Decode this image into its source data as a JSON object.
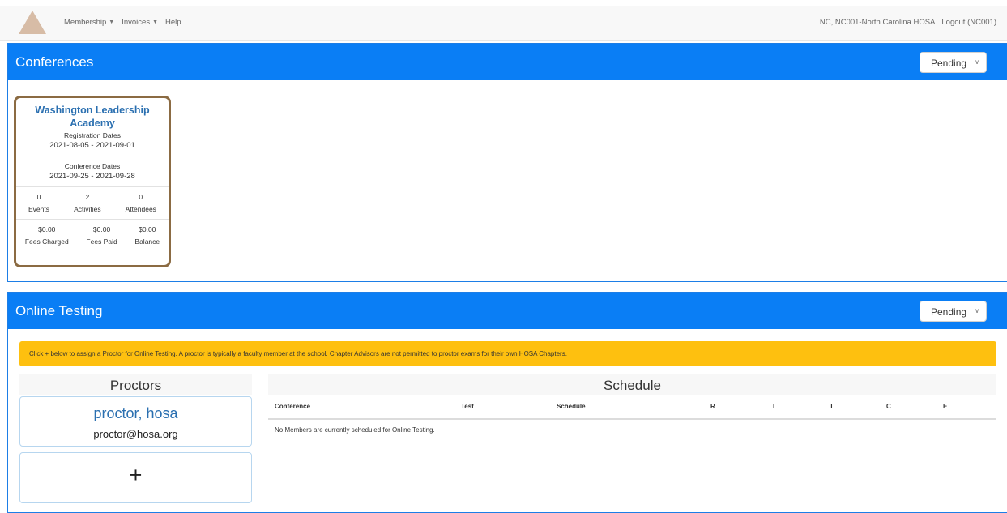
{
  "nav": {
    "menu": [
      {
        "label": "Membership",
        "has_caret": true
      },
      {
        "label": "Invoices",
        "has_caret": true
      },
      {
        "label": "Help",
        "has_caret": false
      }
    ],
    "account": "NC, NC001-North Carolina HOSA",
    "logout": "Logout (NC001)"
  },
  "conferences": {
    "title": "Conferences",
    "filter": "Pending",
    "card": {
      "name": "Washington Leadership Academy",
      "registration_label": "Registration Dates",
      "registration_dates": "2021-08-05 - 2021-09-01",
      "conference_label": "Conference Dates",
      "conference_dates": "2021-09-25 - 2021-09-28",
      "counts": [
        {
          "value": "0",
          "label": "Events"
        },
        {
          "value": "2",
          "label": "Activities"
        },
        {
          "value": "0",
          "label": "Attendees"
        }
      ],
      "fees": [
        {
          "value": "$0.00",
          "label": "Fees Charged"
        },
        {
          "value": "$0.00",
          "label": "Fees Paid"
        },
        {
          "value": "$0.00",
          "label": "Balance"
        }
      ]
    }
  },
  "testing": {
    "title": "Online Testing",
    "filter": "Pending",
    "notice": "Click + below to assign a Proctor for Online Testing. A proctor is typically a faculty member at the school. Chapter Advisors are not permitted to proctor exams for their own HOSA Chapters.",
    "proctors_heading": "Proctors",
    "proctor": {
      "name": "proctor, hosa",
      "email": "proctor@hosa.org"
    },
    "add_label": "+",
    "schedule_heading": "Schedule",
    "columns": [
      "Conference",
      "Test",
      "Schedule",
      "R",
      "L",
      "T",
      "C",
      "E"
    ],
    "empty_message": "No Members are currently scheduled for Online Testing."
  },
  "colors": {
    "primary": "#0a7ef5",
    "warning": "#fec00f",
    "card_border": "#8b6b43",
    "link": "#2a6fb0"
  }
}
